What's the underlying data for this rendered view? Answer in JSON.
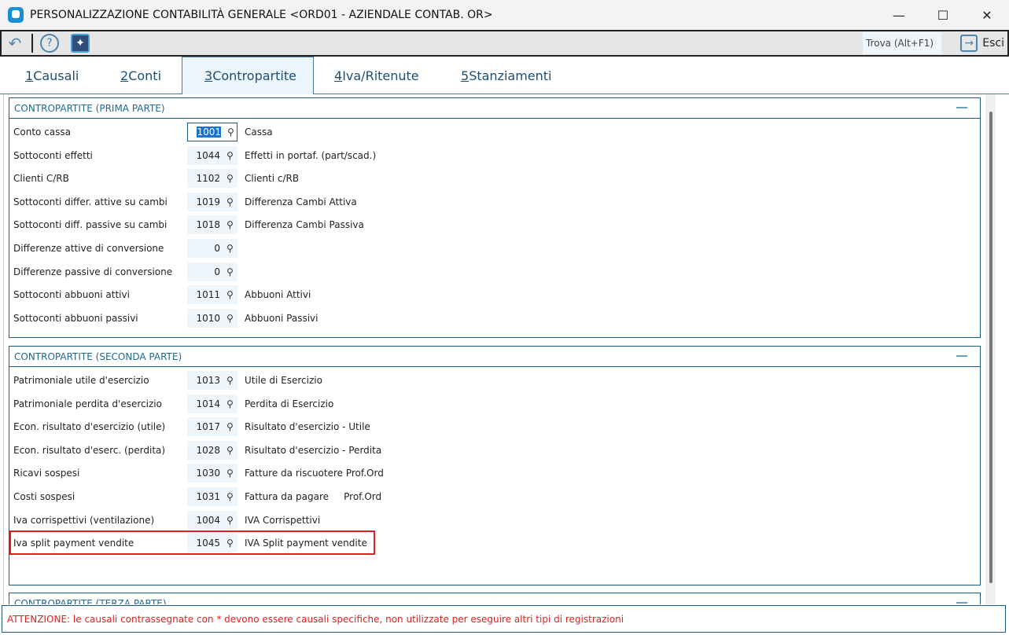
{
  "window": {
    "title": "PERSONALIZZAZIONE CONTABILITÀ GENERALE <ORD01 - AZIENDALE CONTAB. OR>",
    "minimize": "—",
    "maximize": "☐",
    "close": "✕"
  },
  "toolbar": {
    "back_icon": "↶",
    "help_icon": "?",
    "magic_icon": "✦",
    "find": "Trova (Alt+F1)",
    "exit": "Esci",
    "exit_icon": "→"
  },
  "tabs": [
    {
      "num": "1",
      "label": " Causali"
    },
    {
      "num": "2",
      "label": " Conti"
    },
    {
      "num": "3",
      "label": " Contropartite"
    },
    {
      "num": "4",
      "label": " Iva/Ritenute"
    },
    {
      "num": "5",
      "label": " Stanziamenti"
    }
  ],
  "sections": [
    {
      "title": "CONTROPARTITE (PRIMA PARTE)",
      "rows": [
        {
          "label": "Conto cassa",
          "code": "1001",
          "desc": "Cassa"
        },
        {
          "label": "Sottoconti effetti",
          "code": "1044",
          "desc": "Effetti in portaf. (part/scad.)"
        },
        {
          "label": "Clienti C/RB",
          "code": "1102",
          "desc": "Clienti c/RB"
        },
        {
          "label": "Sottoconti differ. attive su cambi",
          "code": "1019",
          "desc": "Differenza Cambi Attiva"
        },
        {
          "label": "Sottoconti diff. passive su cambi",
          "code": "1018",
          "desc": "Differenza Cambi Passiva"
        },
        {
          "label": "Differenze attive di conversione",
          "code": "0",
          "desc": ""
        },
        {
          "label": "Differenze passive di conversione",
          "code": "0",
          "desc": ""
        },
        {
          "label": "Sottoconti abbuoni attivi",
          "code": "1011",
          "desc": "Abbuoni Attivi"
        },
        {
          "label": "Sottoconti abbuoni passivi",
          "code": "1010",
          "desc": "Abbuoni Passivi"
        }
      ]
    },
    {
      "title": "CONTROPARTITE (SECONDA PARTE)",
      "rows": [
        {
          "label": "Patrimoniale utile d'esercizio",
          "code": "1013",
          "desc": "Utile di Esercizio"
        },
        {
          "label": "Patrimoniale perdita d'esercizio",
          "code": "1014",
          "desc": "Perdita di Esercizio"
        },
        {
          "label": "Econ. risultato d'esercizio (utile)",
          "code": "1017",
          "desc": "Risultato d'esercizio - Utile"
        },
        {
          "label": "Econ. risultato d'eserc. (perdita)",
          "code": "1028",
          "desc": "Risultato d'esercizio - Perdita"
        },
        {
          "label": "Ricavi sospesi",
          "code": "1030",
          "desc": "Fatture da riscuotere Prof.Ord"
        },
        {
          "label": "Costi sospesi",
          "code": "1031",
          "desc": "Fattura da pagare     Prof.Ord"
        },
        {
          "label": "Iva corrispettivi (ventilazione)",
          "code": "1004",
          "desc": "IVA Corrispettivi"
        },
        {
          "label": "Iva split payment vendite",
          "code": "1045",
          "desc": "IVA Split payment vendite"
        }
      ]
    },
    {
      "title": "CONTROPARTITE (TERZA PARTE)"
    }
  ],
  "footer": "ATTENZIONE: le causali contrassegnate con * devono essere causali specifiche, non utilizzate per eseguire altri tipi di registrazioni",
  "colors": {
    "accent": "#1e5a7a",
    "warning": "#e02020",
    "field_bg": "#eef6fc"
  }
}
